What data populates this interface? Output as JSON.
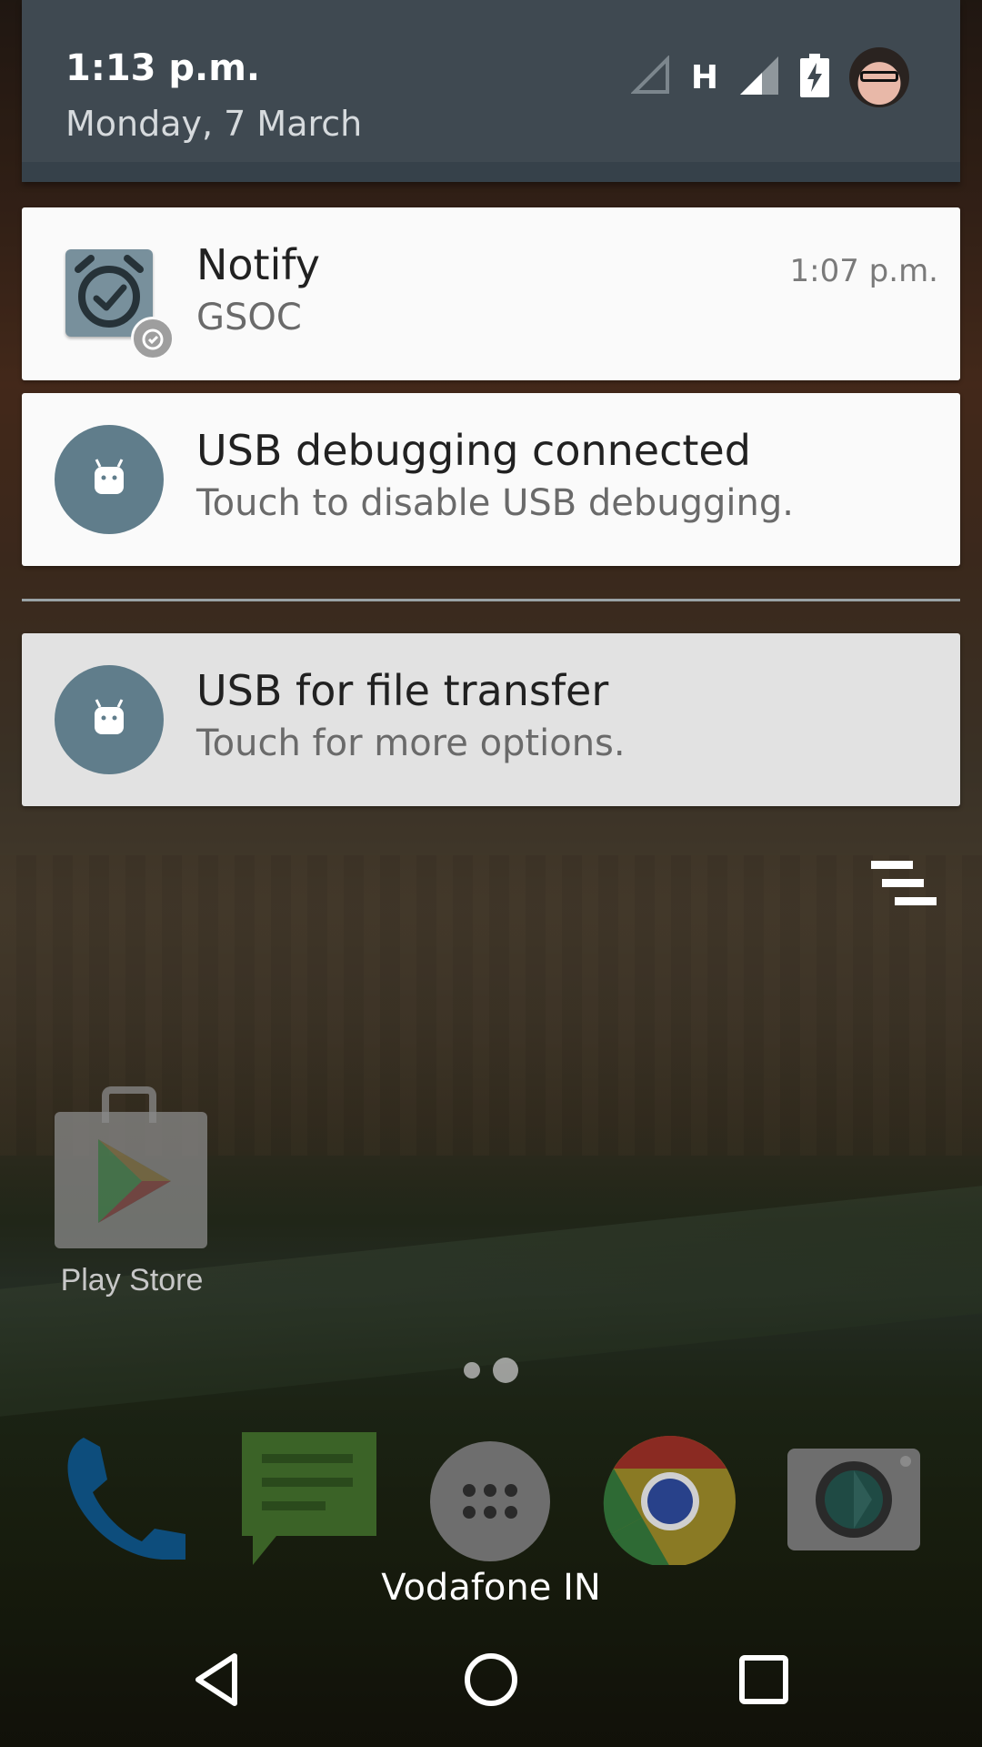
{
  "header": {
    "clock": "1:13 p.m.",
    "date": "Monday, 7 March",
    "network_type": "H"
  },
  "notifications": [
    {
      "app_icon": "alarm-check-icon",
      "title": "Notify",
      "text": "GSOC",
      "time": "1:07 p.m."
    },
    {
      "app_icon": "android-icon",
      "title": "USB debugging connected",
      "text": "Touch to disable USB debugging."
    },
    {
      "app_icon": "android-icon",
      "title": "USB for file transfer",
      "text": "Touch for more options."
    }
  ],
  "home": {
    "apps": [
      {
        "label": "Play Store",
        "icon": "play-store-icon"
      }
    ],
    "dock": [
      "phone-icon",
      "messages-icon",
      "app-drawer-icon",
      "chrome-icon",
      "camera-icon"
    ],
    "carrier": "Vodafone IN"
  },
  "colors": {
    "shade_header": "#3f4951",
    "card_bg": "#fafafa",
    "card_dim_bg": "#e2e2e2",
    "icon_circle": "#607d8b"
  }
}
